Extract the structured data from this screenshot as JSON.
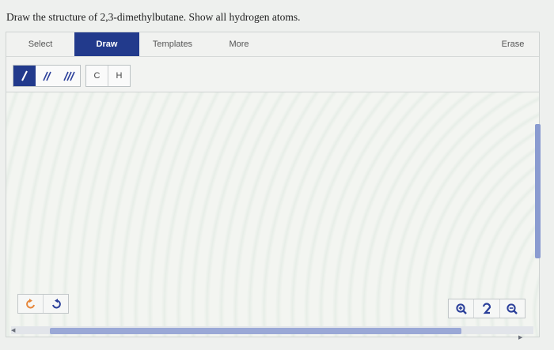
{
  "question": "Draw the structure of 2,3-dimethylbutane. Show all hydrogen atoms.",
  "toolbar": {
    "select": "Select",
    "draw": "Draw",
    "templates": "Templates",
    "more": "More",
    "erase": "Erase"
  },
  "palette": {
    "bonds": [
      {
        "icon": "single-bond-icon",
        "selected": true
      },
      {
        "icon": "double-bond-icon",
        "selected": false
      },
      {
        "icon": "triple-bond-icon",
        "selected": false
      }
    ],
    "atoms": [
      "C",
      "H"
    ]
  },
  "bottom": {
    "undo_icon": "undo-icon",
    "redo_icon": "redo-icon",
    "zoom_in_icon": "zoom-in-icon",
    "reset_zoom_icon": "reset-zoom-icon",
    "zoom_out_icon": "zoom-out-icon"
  },
  "colors": {
    "accent": "#223a8c",
    "icon_blue": "#2b3f9a",
    "undo_orange": "#e6863a",
    "scrollbar": "#8a9bd0"
  }
}
